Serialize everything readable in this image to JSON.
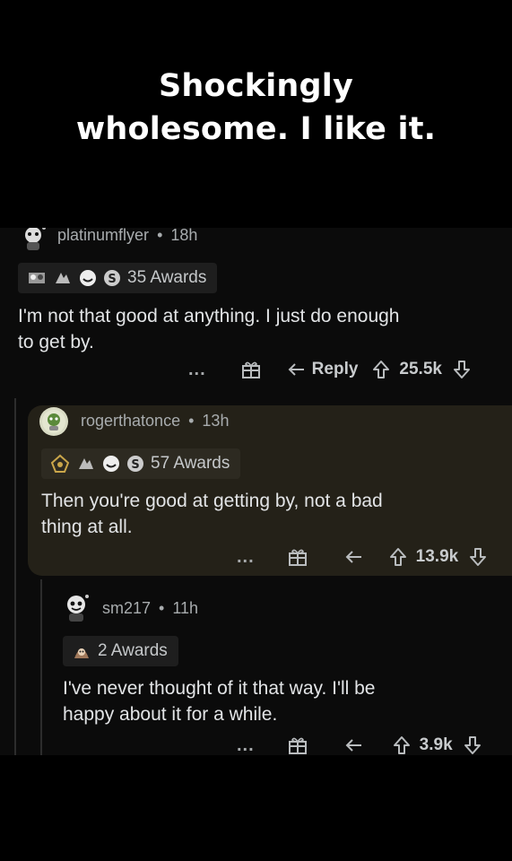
{
  "caption": {
    "line1": "Shockingly",
    "line2": "wholesome. I like it."
  },
  "comments": [
    {
      "username": "platinumflyer",
      "age": "18h",
      "awards": "35 Awards",
      "text_line1": "I'm not that good at anything. I just do enough",
      "text_line2": "to get by.",
      "more": "...",
      "reply_label": "Reply",
      "votes": "25.5k"
    },
    {
      "username": "rogerthatonce",
      "age": "13h",
      "awards": "57 Awards",
      "text_line1": "Then you're good at getting by, not a bad",
      "text_line2": "thing at all.",
      "more": "...",
      "votes": "13.9k"
    },
    {
      "username": "sm217",
      "age": "11h",
      "awards": "2 Awards",
      "text_line1": "I've never thought of it that way. I'll be",
      "text_line2": "happy about it for a while.",
      "more": "...",
      "votes": "3.9k"
    }
  ],
  "separator": "•",
  "icons": [
    "snoo-avatar-icon",
    "award-icon",
    "gift-icon",
    "reply-arrow-icon",
    "upvote-icon",
    "downvote-icon"
  ]
}
